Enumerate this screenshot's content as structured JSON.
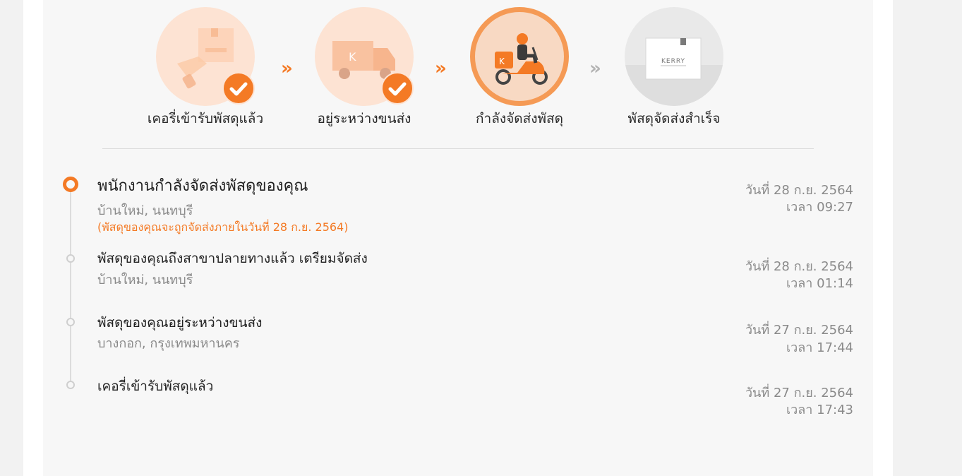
{
  "steps": [
    {
      "label": "เคอรี่เข้ารับพัสดุแล้ว",
      "state": "done",
      "icon": "parcel-handover-icon"
    },
    {
      "label": "อยู่ระหว่างขนส่ง",
      "state": "done",
      "icon": "delivery-truck-icon"
    },
    {
      "label": "กำลังจัดส่งพัสดุ",
      "state": "current",
      "icon": "delivery-scooter-icon"
    },
    {
      "label": "พัสดุจัดส่งสำเร็จ",
      "state": "pending",
      "icon": "parcel-box-icon"
    }
  ],
  "box_brand": "KERRY",
  "events": [
    {
      "title": "พนักงานกำลังจัดส่งพัสดุของคุณ",
      "location": "บ้านใหม่, นนทบุรี",
      "note": "(พัสดุของคุณจะถูกจัดส่งภายในวันที่ 28 ก.ย. 2564)",
      "date": "วันที่ 28 ก.ย. 2564",
      "time": "เวลา 09:27"
    },
    {
      "title": "พัสดุของคุณถึงสาขาปลายทางแล้ว เตรียมจัดส่ง",
      "location": "บ้านใหม่, นนทบุรี",
      "date": "วันที่ 28 ก.ย. 2564",
      "time": "เวลา 01:14"
    },
    {
      "title": "พัสดุของคุณอยู่ระหว่างขนส่ง",
      "location": "บางกอก, กรุงเทพมหานคร",
      "date": "วันที่ 27 ก.ย. 2564",
      "time": "เวลา 17:44"
    },
    {
      "title": "เคอรี่เข้ารับพัสดุแล้ว",
      "date": "วันที่ 27 ก.ย. 2564",
      "time": "เวลา 17:43"
    }
  ],
  "colors": {
    "accent": "#f47a25",
    "done_bg": "#fde3d3",
    "pending_bg": "#e9e9e9",
    "text": "#222222",
    "muted": "#8a8a8a"
  }
}
